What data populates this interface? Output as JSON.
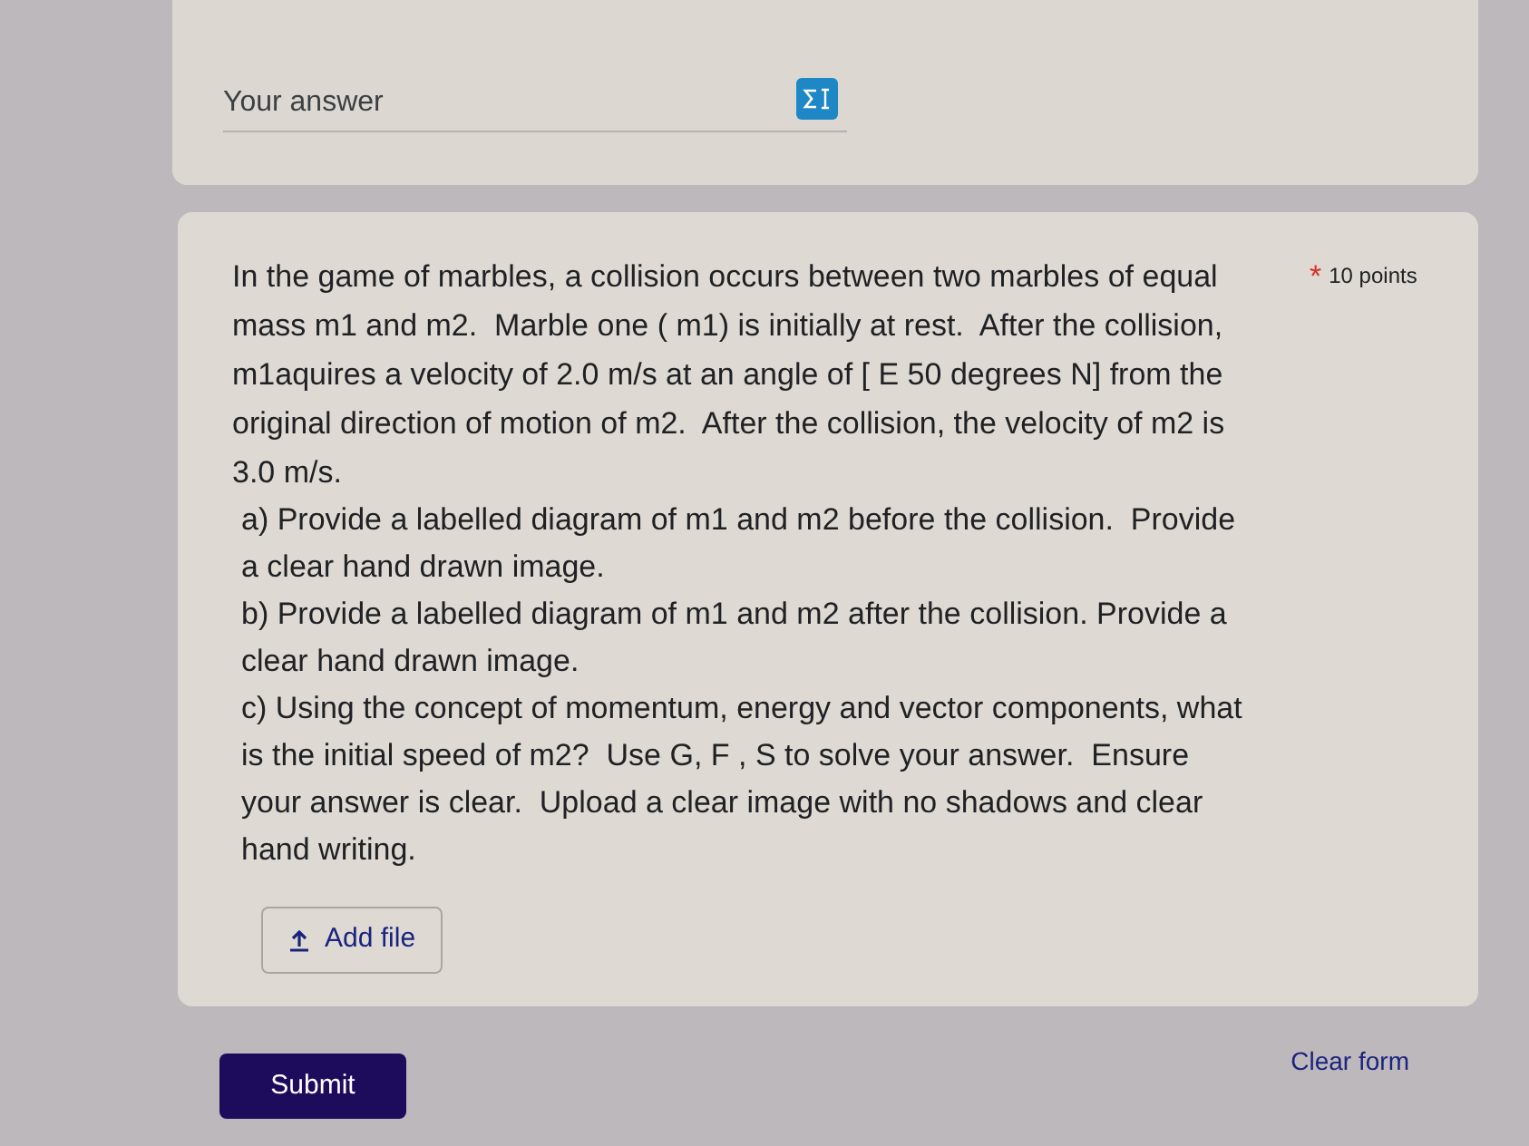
{
  "previous_question": {
    "answer_field": {
      "placeholder": "Your answer"
    }
  },
  "question": {
    "text": "In the game of marbles, a collision occurs between two marbles of equal mass m1 and m2.  Marble one ( m1) is initially at rest.  After the collision, m1aquires a velocity of 2.0 m/s at an angle of [ E 50 degrees N] from the original direction of motion of m2.  After the collision, the velocity of m2 is 3.0 m/s.",
    "required_mark": "*",
    "points": "10 points",
    "parts": [
      "a) Provide a labelled diagram of m1 and m2 before the collision.  Provide a clear hand drawn image.",
      "b) Provide a labelled diagram of m1 and m2 after the collision. Provide a clear hand drawn image.",
      "c) Using the concept of momentum, energy and vector components, what is the initial speed of m2?  Use G, F , S to solve your answer.  Ensure your answer is clear.  Upload a clear image with no shadows and clear hand writing."
    ],
    "upload_button": "Add file"
  },
  "actions": {
    "submit": "Submit",
    "clear": "Clear form"
  }
}
